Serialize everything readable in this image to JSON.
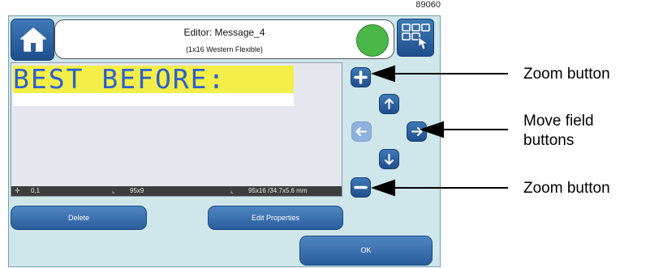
{
  "figure_id": "89060",
  "header": {
    "title": "Editor: Message_4",
    "subtitle": "(1x16 Western Flexible)",
    "status_color": "#4ab848"
  },
  "icons": {
    "home": "home-icon",
    "grid_touch": "grid-touch-icon",
    "zoom_in": "plus-icon",
    "zoom_out": "minus-icon",
    "up": "arrow-up-icon",
    "down": "arrow-down-icon",
    "left": "arrow-left-icon",
    "right": "arrow-right-icon"
  },
  "canvas": {
    "message_text": "BEST BEFORE:",
    "field_color": "#f3ee48",
    "text_color": "#2b5fd1"
  },
  "statusbar": {
    "cursor": "0,1",
    "field_size": "95x9",
    "message_size": "95x16 /34.7x5.6 mm"
  },
  "buttons": {
    "delete": "Delete",
    "edit_properties": "Edit Properties",
    "ok": "OK"
  },
  "left_arrow_disabled": true,
  "callouts": {
    "zoom_top": "Zoom button",
    "move_field": "Move field\nbuttons",
    "move_field_line1": "Move field",
    "move_field_line2": "buttons",
    "zoom_bottom": "Zoom button"
  }
}
